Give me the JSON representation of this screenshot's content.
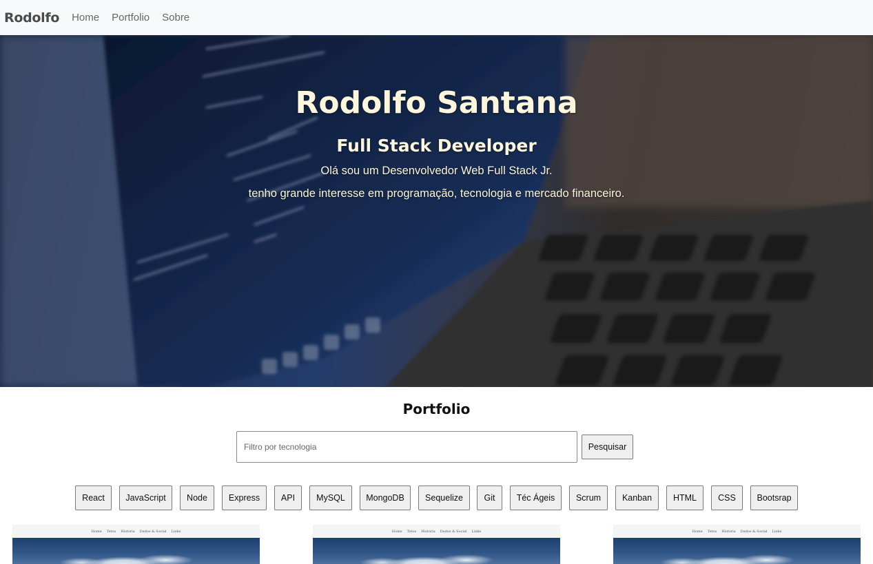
{
  "navbar": {
    "brand": "Rodolfo",
    "links": [
      {
        "label": "Home"
      },
      {
        "label": "Portfolio"
      },
      {
        "label": "Sobre"
      }
    ]
  },
  "hero": {
    "title": "Rodolfo Santana",
    "subtitle": "Full Stack Developer",
    "line1": "Olá sou um Desenvolvedor Web Full Stack Jr.",
    "line2": "tenho grande interesse em programação, tecnologia e mercado financeiro.",
    "text_color": "#fbf6dc"
  },
  "portfolio": {
    "title": "Portfolio",
    "search_placeholder": "Filtro por tecnologia",
    "search_value": "",
    "search_button": "Pesquisar",
    "filters": [
      "React",
      "JavaScript",
      "Node",
      "Express",
      "API",
      "MySQL",
      "MongoDB",
      "Sequelize",
      "Git",
      "Téc Ágeis",
      "Scrum",
      "Kanban",
      "HTML",
      "CSS",
      "Bootsrap"
    ],
    "card_nav_items": [
      "Home",
      "Tetos",
      "Historia",
      "Dados & Social",
      "Links"
    ]
  }
}
